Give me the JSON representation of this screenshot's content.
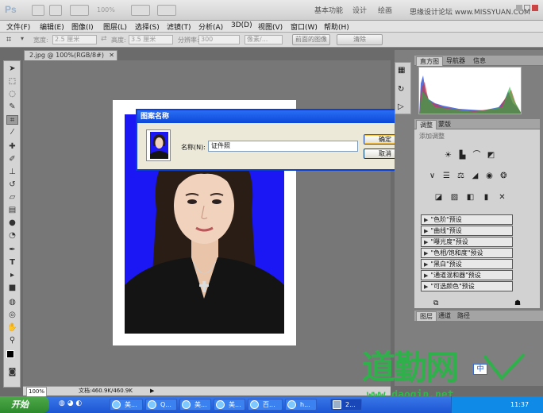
{
  "app": {
    "logo": "Ps",
    "zoom": "100%",
    "workspaces": [
      "基本功能",
      "设计",
      "绘画"
    ],
    "watermark_top": "思缘设计论坛 www.MISSYUAN.COM"
  },
  "menu": [
    "文件(F)",
    "编辑(E)",
    "图像(I)",
    "图层(L)",
    "选择(S)",
    "滤镜(T)",
    "分析(A)",
    "3D(D)",
    "视图(V)",
    "窗口(W)",
    "帮助(H)"
  ],
  "options": {
    "width_label": "宽度:",
    "width_value": "2.5 厘米",
    "height_label": "高度:",
    "height_value": "3.5 厘米",
    "resolution_label": "分辨率:",
    "resolution_value": "300",
    "unit": "像素/...",
    "front_image_button": "前面的图像",
    "clear_button": "清除"
  },
  "document": {
    "tab_title": "2.jpg @ 100%(RGB/8#)",
    "status_zoom": "100%",
    "status_doc": "文档:460.9K/460.9K"
  },
  "dialog": {
    "title": "图案名称",
    "name_label": "名称(N):",
    "name_value": "证件照",
    "ok": "确定",
    "cancel": "取消"
  },
  "panels": {
    "top_tabs": [
      "直方图",
      "导航器",
      "信息"
    ],
    "adjust_tabs": [
      "调整",
      "蒙版"
    ],
    "adjust_hint": "添加调整",
    "presets": [
      "\"色阶\"预设",
      "\"曲线\"预设",
      "\"曝光度\"预设",
      "\"色相/饱和度\"预设",
      "\"黑白\"预设",
      "\"通道混和器\"预设",
      "\"可选颜色\"预设"
    ],
    "layer_tabs": [
      "图层",
      "通道",
      "路径"
    ]
  },
  "taskbar": {
    "start": "开始",
    "items": [
      "美...",
      "Q...",
      "美...",
      "美...",
      "百...",
      "h...",
      "2...",
      "...",
      "...",
      "...",
      "..."
    ],
    "ime": "中",
    "clock": "11:37"
  },
  "watermark_logo": {
    "text": "道勤网",
    "url": "www.daoqin.net"
  },
  "colors": {
    "photo_bg": "#1a17f4",
    "dialog_title": "#0b47d8",
    "taskbar": "#2a63dc",
    "start_green": "#3d9b3b",
    "watermark_green": "#2fb04a"
  }
}
